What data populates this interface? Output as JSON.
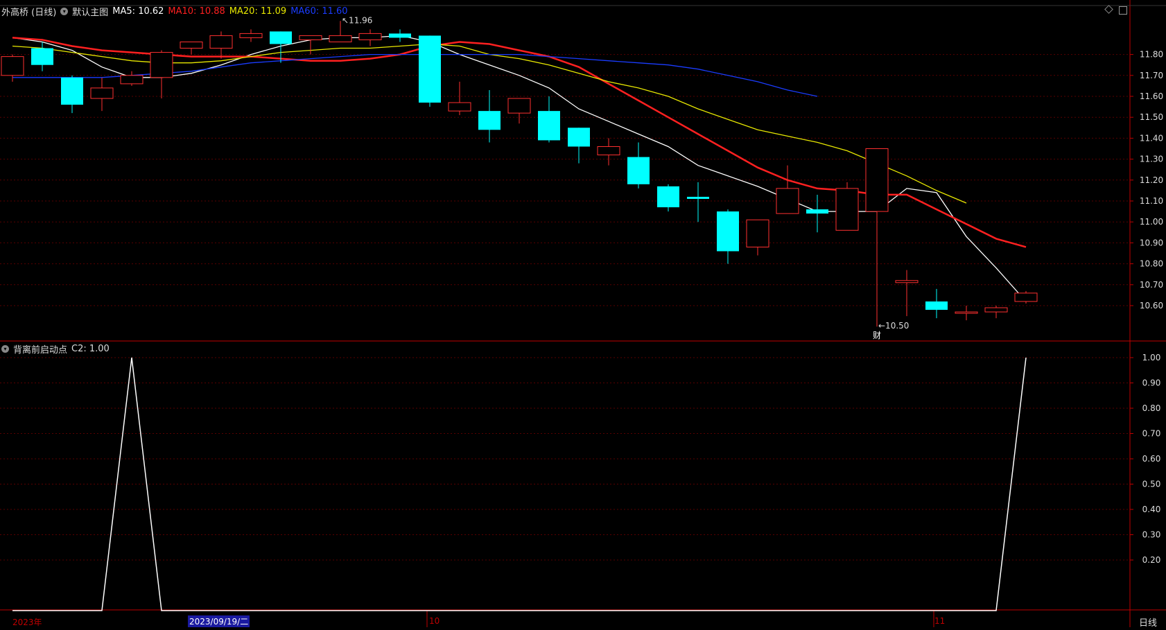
{
  "main_panel": {
    "stock_title": "外高桥 (日线)",
    "template_label": "默认主图",
    "indicators": [
      {
        "label": "MA5: 10.62",
        "color": "#ffffff"
      },
      {
        "label": "MA10: 10.88",
        "color": "#ff2020"
      },
      {
        "label": "MA20: 11.09",
        "color": "#e8e800"
      },
      {
        "label": "MA60: 11.60",
        "color": "#1a3cff"
      }
    ],
    "price_ticks": [
      "11.80",
      "11.70",
      "11.60",
      "11.50",
      "11.40",
      "11.30",
      "11.20",
      "11.10",
      "11.00",
      "10.90",
      "10.80",
      "10.70",
      "10.60"
    ],
    "high_marker": "11.96",
    "low_marker": "10.50",
    "event_marker": "财"
  },
  "sub_panel": {
    "indicator_name": "背离前启动点",
    "value_label": "C2: 1.00",
    "ticks": [
      "1.00",
      "0.90",
      "0.80",
      "0.70",
      "0.60",
      "0.50",
      "0.40",
      "0.30",
      "0.20"
    ]
  },
  "time_axis": {
    "year_label": "2023年",
    "cursor_date": "2023/09/19/二",
    "month_oct": "10",
    "month_nov": "11",
    "period": "日线"
  },
  "colors": {
    "up": "#ff3030",
    "down": "#00ffff",
    "axis": "#c00000",
    "grid": "#5a0000"
  },
  "chart_data": [
    {
      "type": "candlestick",
      "title": "外高桥 (日线)",
      "ylim": [
        10.47,
        11.97
      ],
      "candles": [
        {
          "o": 11.7,
          "h": 11.8,
          "l": 11.67,
          "c": 11.79
        },
        {
          "o": 11.83,
          "h": 11.86,
          "l": 11.72,
          "c": 11.75
        },
        {
          "o": 11.69,
          "h": 11.7,
          "l": 11.52,
          "c": 11.56
        },
        {
          "o": 11.59,
          "h": 11.69,
          "l": 11.53,
          "c": 11.64
        },
        {
          "o": 11.66,
          "h": 11.72,
          "l": 11.65,
          "c": 11.7
        },
        {
          "o": 11.69,
          "h": 11.82,
          "l": 11.59,
          "c": 11.81
        },
        {
          "o": 11.83,
          "h": 11.86,
          "l": 11.8,
          "c": 11.86
        },
        {
          "o": 11.83,
          "h": 11.91,
          "l": 11.78,
          "c": 11.89
        },
        {
          "o": 11.88,
          "h": 11.92,
          "l": 11.86,
          "c": 11.9
        },
        {
          "o": 11.91,
          "h": 11.91,
          "l": 11.76,
          "c": 11.85
        },
        {
          "o": 11.87,
          "h": 11.89,
          "l": 11.8,
          "c": 11.89
        },
        {
          "o": 11.86,
          "h": 11.96,
          "l": 11.86,
          "c": 11.89
        },
        {
          "o": 11.87,
          "h": 11.92,
          "l": 11.84,
          "c": 11.9
        },
        {
          "o": 11.9,
          "h": 11.92,
          "l": 11.86,
          "c": 11.88
        },
        {
          "o": 11.89,
          "h": 11.89,
          "l": 11.55,
          "c": 11.57
        },
        {
          "o": 11.53,
          "h": 11.67,
          "l": 11.51,
          "c": 11.57
        },
        {
          "o": 11.53,
          "h": 11.63,
          "l": 11.38,
          "c": 11.44
        },
        {
          "o": 11.52,
          "h": 11.59,
          "l": 11.47,
          "c": 11.59
        },
        {
          "o": 11.53,
          "h": 11.6,
          "l": 11.38,
          "c": 11.39
        },
        {
          "o": 11.45,
          "h": 11.45,
          "l": 11.28,
          "c": 11.36
        },
        {
          "o": 11.32,
          "h": 11.4,
          "l": 11.27,
          "c": 11.36
        },
        {
          "o": 11.31,
          "h": 11.38,
          "l": 11.16,
          "c": 11.18
        },
        {
          "o": 11.17,
          "h": 11.18,
          "l": 11.05,
          "c": 11.07
        },
        {
          "o": 11.12,
          "h": 11.19,
          "l": 11.0,
          "c": 11.11
        },
        {
          "o": 11.05,
          "h": 11.06,
          "l": 10.8,
          "c": 10.86
        },
        {
          "o": 10.88,
          "h": 11.01,
          "l": 10.84,
          "c": 11.01
        },
        {
          "o": 11.04,
          "h": 11.27,
          "l": 11.04,
          "c": 11.16
        },
        {
          "o": 11.06,
          "h": 11.13,
          "l": 10.95,
          "c": 11.04
        },
        {
          "o": 10.96,
          "h": 11.19,
          "l": 10.96,
          "c": 11.16
        },
        {
          "o": 11.05,
          "h": 11.35,
          "l": 10.5,
          "c": 11.35
        },
        {
          "o": 10.71,
          "h": 10.77,
          "l": 10.55,
          "c": 10.72
        },
        {
          "o": 10.62,
          "h": 10.68,
          "l": 10.54,
          "c": 10.58
        },
        {
          "o": 10.57,
          "h": 10.6,
          "l": 10.53,
          "c": 10.57
        },
        {
          "o": 10.57,
          "h": 10.6,
          "l": 10.54,
          "c": 10.59
        },
        {
          "o": 10.62,
          "h": 10.67,
          "l": 10.61,
          "c": 10.66
        }
      ],
      "series": [
        {
          "name": "MA5",
          "color": "#ffffff",
          "values": [
            11.88,
            11.86,
            11.82,
            11.74,
            11.69,
            11.69,
            11.71,
            11.75,
            11.8,
            11.84,
            11.87,
            11.88,
            11.88,
            11.89,
            11.86,
            11.8,
            11.75,
            11.7,
            11.64,
            11.54,
            11.48,
            11.42,
            11.36,
            11.27,
            11.22,
            11.17,
            11.11,
            11.05,
            11.05,
            11.05,
            11.16,
            11.14,
            10.93,
            10.78,
            10.62
          ]
        },
        {
          "name": "MA10",
          "color": "#ff2020",
          "values": [
            11.88,
            11.87,
            11.84,
            11.82,
            11.81,
            11.8,
            11.79,
            11.79,
            11.79,
            11.78,
            11.77,
            11.77,
            11.78,
            11.8,
            11.84,
            11.86,
            11.85,
            11.82,
            11.79,
            11.74,
            11.66,
            11.58,
            11.5,
            11.42,
            11.34,
            11.26,
            11.2,
            11.16,
            11.15,
            11.13,
            11.13,
            11.06,
            10.99,
            10.92,
            10.88
          ]
        },
        {
          "name": "MA20",
          "color": "#e8e800",
          "values": [
            11.84,
            11.83,
            11.81,
            11.79,
            11.77,
            11.76,
            11.76,
            11.77,
            11.79,
            11.81,
            11.82,
            11.83,
            11.83,
            11.84,
            11.85,
            11.84,
            11.8,
            11.78,
            11.75,
            11.71,
            11.67,
            11.64,
            11.6,
            11.54,
            11.49,
            11.44,
            11.41,
            11.38,
            11.34,
            11.28,
            11.22,
            11.15,
            11.09
          ]
        },
        {
          "name": "MA60",
          "color": "#1a3cff",
          "values": [
            11.69,
            11.69,
            11.69,
            11.69,
            11.7,
            11.71,
            11.72,
            11.74,
            11.76,
            11.77,
            11.78,
            11.79,
            11.8,
            11.8,
            11.8,
            11.8,
            11.8,
            11.8,
            11.79,
            11.78,
            11.77,
            11.76,
            11.75,
            11.73,
            11.7,
            11.67,
            11.63,
            11.6
          ]
        }
      ]
    },
    {
      "type": "line",
      "title": "背离前启动点",
      "ylim": [
        0,
        1.0
      ],
      "series": [
        {
          "name": "C2",
          "color": "#ffffff",
          "values": [
            0,
            0,
            0,
            0,
            1,
            0,
            0,
            0,
            0,
            0,
            0,
            0,
            0,
            0,
            0,
            0,
            0,
            0,
            0,
            0,
            0,
            0,
            0,
            0,
            0,
            0,
            0,
            0,
            0,
            0,
            0,
            0,
            0,
            0,
            1
          ]
        }
      ]
    }
  ]
}
